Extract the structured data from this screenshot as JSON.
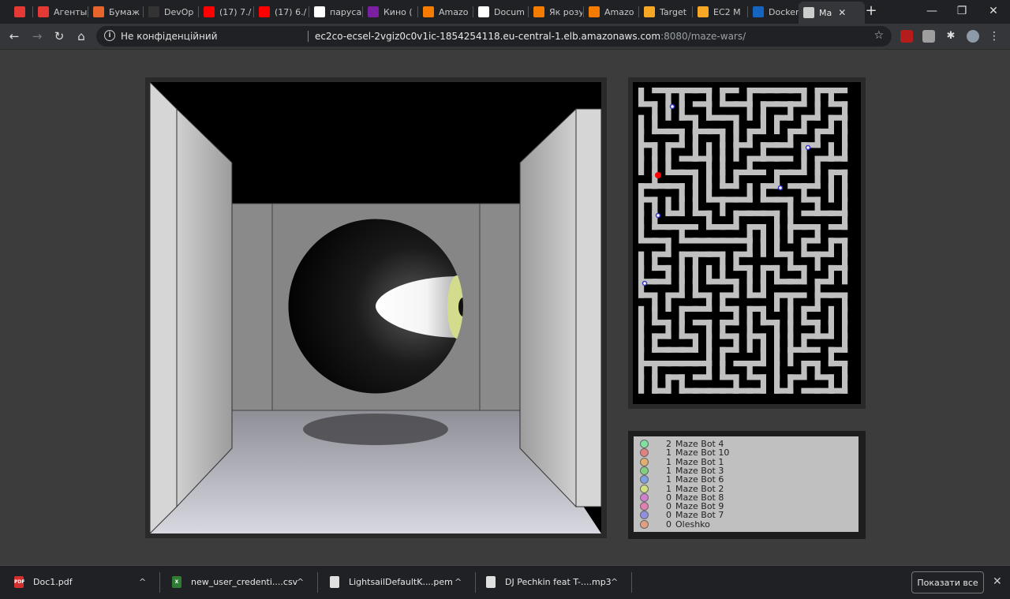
{
  "tabs": [
    {
      "label": "",
      "icon": "news-icon",
      "color": "#e53935"
    },
    {
      "label": "Агенты",
      "icon": "lf-icon",
      "color": "#e53935"
    },
    {
      "label": "Бумаж",
      "icon": "f-icon",
      "color": "#e8642c"
    },
    {
      "label": "DevOp",
      "icon": "github-icon",
      "color": "#333333"
    },
    {
      "label": "(17) 7./",
      "icon": "youtube-icon",
      "color": "#ff0000"
    },
    {
      "label": "(17) 6./",
      "icon": "youtube-icon",
      "color": "#ff0000"
    },
    {
      "label": "паруса",
      "icon": "google-icon",
      "color": "#ffffff"
    },
    {
      "label": "Кино (",
      "icon": "kino-icon",
      "color": "#7b1fa2"
    },
    {
      "label": "Amazo",
      "icon": "aws-icon",
      "color": "#f57c00"
    },
    {
      "label": "Docum",
      "icon": "globe-icon",
      "color": "#ffffff"
    },
    {
      "label": "Як розу",
      "icon": "aws-icon",
      "color": "#f57c00"
    },
    {
      "label": "Amazo",
      "icon": "aws-icon",
      "color": "#f57c00"
    },
    {
      "label": "Target",
      "icon": "box-icon",
      "color": "#f9a825"
    },
    {
      "label": "EC2 M",
      "icon": "box-icon",
      "color": "#f9a825"
    },
    {
      "label": "Docker",
      "icon": "docker-icon",
      "color": "#1565c0"
    },
    {
      "label": "Ma",
      "icon": "maze-icon",
      "color": "#cccccc",
      "active": true
    }
  ],
  "toolbar": {
    "security_label": "Не конфіденційний",
    "url_host": "ec2co-ecsel-2vgiz0c0v1ic-1854254118.eu-central-1.elb.amazonaws.com",
    "url_path": ":8080/maze-wars/"
  },
  "maze": {
    "cols": 16,
    "rows": 23,
    "path_color": "#c0c0c0",
    "wall_color": "#000000",
    "player_color": "#ff0000",
    "bot_color": "#3333cc"
  },
  "scores": [
    {
      "points": "2",
      "name": "Maze Bot 4",
      "color": "#80e0a0"
    },
    {
      "points": "1",
      "name": "Maze Bot 10",
      "color": "#e08080"
    },
    {
      "points": "1",
      "name": "Maze Bot 1",
      "color": "#e0b070"
    },
    {
      "points": "1",
      "name": "Maze Bot 3",
      "color": "#80d080"
    },
    {
      "points": "1",
      "name": "Maze Bot 6",
      "color": "#80a0e0"
    },
    {
      "points": "1",
      "name": "Maze Bot 2",
      "color": "#d0e080"
    },
    {
      "points": "0",
      "name": "Maze Bot 8",
      "color": "#d080d0"
    },
    {
      "points": "0",
      "name": "Maze Bot 9",
      "color": "#e080b0"
    },
    {
      "points": "0",
      "name": "Maze Bot 7",
      "color": "#9090e0"
    },
    {
      "points": "0",
      "name": "Oleshko",
      "color": "#e0a080"
    }
  ],
  "downloads": [
    {
      "name": "Doc1.pdf",
      "icon": "pdf-icon",
      "color": "#d32f2f",
      "tag": "PDF"
    },
    {
      "name": "new_user_credenti....csv",
      "icon": "csv-icon",
      "color": "#2e7d32",
      "tag": "X"
    },
    {
      "name": "LightsailDefaultK....pem",
      "icon": "file-icon",
      "color": "#e0e0e0",
      "tag": ""
    },
    {
      "name": "DJ Pechkin feat T-....mp3",
      "icon": "audio-icon",
      "color": "#e0e0e0",
      "tag": ""
    }
  ],
  "downloads_bar": {
    "show_all": "Показати все"
  }
}
